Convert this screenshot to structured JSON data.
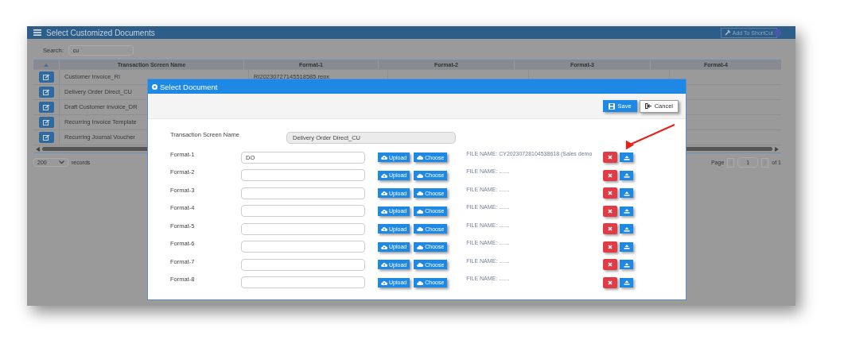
{
  "app": {
    "title": "Select Customized Documents",
    "shortcut_button": "Add To ShortCut",
    "search": {
      "label": "Search:",
      "value": "cu"
    },
    "table": {
      "columns": [
        "Transaction Screen Name",
        "Format-1",
        "Format-2",
        "Format-3",
        "Format-4"
      ],
      "rows": [
        {
          "name": "Customer Invoice_RI",
          "format_1": "RI20230727145518585.repx"
        },
        {
          "name": "Delivery Order Direct_CU"
        },
        {
          "name": "Draft Customer Invoice_DR"
        },
        {
          "name": "Recurring Invoice Template"
        },
        {
          "name": "Recurring Journal Voucher"
        }
      ]
    },
    "page_size": "200",
    "records_label": "records",
    "pagination": {
      "label": "Page",
      "value": "1",
      "total": "of 1"
    }
  },
  "dialog": {
    "title": "Select Document",
    "save": "Save",
    "cancel": "Cancel",
    "screen_name": {
      "label": "Transaction Screen Name",
      "value": "Delivery Order Direct_CU"
    },
    "formats": [
      {
        "label": "Format-1",
        "value": "DO",
        "upload": "Upload",
        "choose": "Choose",
        "file_name": "FILE NAME: CY20230728104538618 (Sales demo"
      },
      {
        "label": "Format-2",
        "upload": "Upload",
        "choose": "Choose",
        "file_name": "FILE NAME: ......."
      },
      {
        "label": "Format-3",
        "upload": "Upload",
        "choose": "Choose",
        "file_name": "FILE NAME: ......."
      },
      {
        "label": "Format-4",
        "upload": "Upload",
        "choose": "Choose",
        "file_name": "FILE NAME: ......."
      },
      {
        "label": "Format-5",
        "upload": "Upload",
        "choose": "Choose",
        "file_name": "FILE NAME: ......."
      },
      {
        "label": "Format-6",
        "upload": "Upload",
        "choose": "Choose",
        "file_name": "FILE NAME: ......."
      },
      {
        "label": "Format-7",
        "upload": "Upload",
        "choose": "Choose",
        "file_name": "FILE NAME: ......."
      },
      {
        "label": "Format-8",
        "upload": "Upload",
        "choose": "Choose",
        "file_name": "FILE NAME: ......."
      }
    ]
  }
}
